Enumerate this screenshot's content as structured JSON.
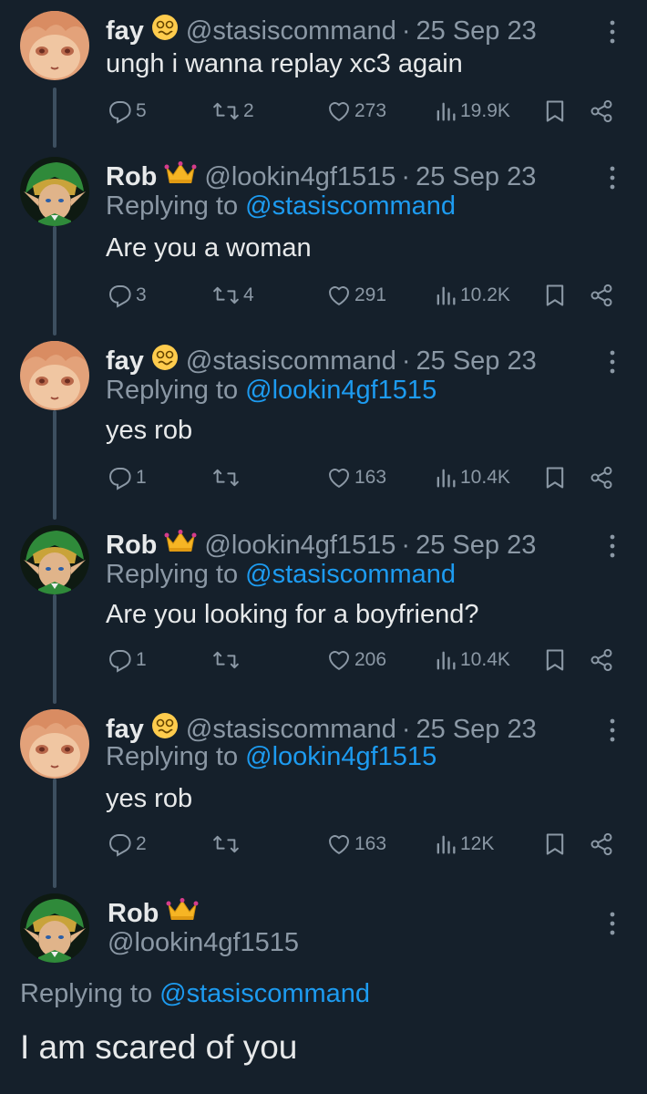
{
  "colors": {
    "background": "#15202b",
    "primary_text": "#e7e9ea",
    "secondary_text": "#8b98a5",
    "link": "#1d9bf0",
    "thread_line": "#3d4f60"
  },
  "tweets": [
    {
      "name": "fay",
      "badge": "woozy-face-emoji",
      "handle": "@stasiscommand",
      "separator": "·",
      "date": "25 Sep 23",
      "replying_prefix": "",
      "replying_to": "",
      "text": "ungh i wanna replay xc3 again",
      "replies": "5",
      "retweets": "2",
      "likes": "273",
      "views": "19.9K"
    },
    {
      "name": "Rob",
      "badge": "crown-emoji",
      "handle": "@lookin4gf1515",
      "separator": "·",
      "date": "25 Sep 23",
      "replying_prefix": "Replying to",
      "replying_to": "@stasiscommand",
      "text": "Are you a woman",
      "replies": "3",
      "retweets": "4",
      "likes": "291",
      "views": "10.2K"
    },
    {
      "name": "fay",
      "badge": "woozy-face-emoji",
      "handle": "@stasiscommand",
      "separator": "·",
      "date": "25 Sep 23",
      "replying_prefix": "Replying to",
      "replying_to": "@lookin4gf1515",
      "text": "yes rob",
      "replies": "1",
      "retweets": "",
      "likes": "163",
      "views": "10.4K"
    },
    {
      "name": "Rob",
      "badge": "crown-emoji",
      "handle": "@lookin4gf1515",
      "separator": "·",
      "date": "25 Sep 23",
      "replying_prefix": "Replying to",
      "replying_to": "@stasiscommand",
      "text": "Are you looking for a boyfriend?",
      "replies": "1",
      "retweets": "",
      "likes": "206",
      "views": "10.4K"
    },
    {
      "name": "fay",
      "badge": "woozy-face-emoji",
      "handle": "@stasiscommand",
      "separator": "·",
      "date": "25 Sep 23",
      "replying_prefix": "Replying to",
      "replying_to": "@lookin4gf1515",
      "text": "yes rob",
      "replies": "2",
      "retweets": "",
      "likes": "163",
      "views": "12K"
    }
  ],
  "focused_tweet": {
    "name": "Rob",
    "badge": "crown-emoji",
    "handle": "@lookin4gf1515",
    "replying_prefix": "Replying to",
    "replying_to": "@stasiscommand",
    "text": "I am scared of you"
  }
}
